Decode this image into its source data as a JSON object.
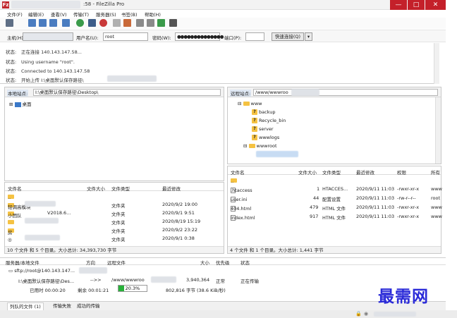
{
  "window": {
    "title": ":58 - FileZilla Pro",
    "app_icon": "Fz",
    "minimize": "—",
    "maximize": "□",
    "close": "✕"
  },
  "menu": [
    "文件(F)",
    "编辑(E)",
    "查看(V)",
    "传输(T)",
    "服务器(S)",
    "书签(B)",
    "帮助(H)"
  ],
  "quickconnect": {
    "host_label": "主机(H):",
    "username_label": "用户名(U):",
    "username_value": "root",
    "password_label": "密码(W):",
    "password_value": "●●●●●●●●●●●●●●",
    "port_label": "端口(P):",
    "port_value": "",
    "connect_button": "快速连接(Q)",
    "dropdown": "▾"
  },
  "log": [
    {
      "key": "状态:",
      "text": "正在连接 140.143.147.58..."
    },
    {
      "key": "状态:",
      "text": "Using username \"root\"."
    },
    {
      "key": "状态:",
      "text": "Connected to 140.143.147.58"
    },
    {
      "key": "状态:",
      "text": "开始上传 I:\\桌面默认保存路径\\"
    }
  ],
  "local": {
    "site_label": "本地站点:",
    "path": "I:\\桌面默认保存路径\\Desktop\\",
    "tree": [
      {
        "label": "桌面"
      }
    ],
    "columns": [
      "文件名",
      "文件大小",
      "文件类型",
      "最近修改"
    ],
    "files": [
      {
        "name": "..",
        "size": "",
        "type": "",
        "modified": ""
      },
      {
        "name": "轻调高模块",
        "size": "",
        "type": "文件夹",
        "modified": "2020/9/2 19:00"
      },
      {
        "name": "小团队",
        "size": "V2018.6...",
        "type": "文件夹",
        "modified": "2020/9/1 9:51"
      },
      {
        "name": "",
        "size": "",
        "type": "文件夹",
        "modified": "2020/8/19 15:19"
      },
      {
        "name": "房",
        "size": "",
        "type": "文件夹",
        "modified": "2020/9/2 23:22"
      },
      {
        "name": "",
        "size": "",
        "type": "文件夹",
        "modified": "2020/9/1 0:38"
      }
    ],
    "status": "10 个文件 和 5 个目录。大小总计: 34,393,730 字节"
  },
  "remote": {
    "site_label": "远程站点:",
    "path": "/www/wwwroo",
    "tree": [
      {
        "label": "www",
        "kind": "folder"
      },
      {
        "label": "backup",
        "kind": "question"
      },
      {
        "label": "Recycle_bin",
        "kind": "question"
      },
      {
        "label": "server",
        "kind": "question"
      },
      {
        "label": "wwwlogs",
        "kind": "question"
      },
      {
        "label": "wwwroot",
        "kind": "folder"
      }
    ],
    "columns": [
      "文件名",
      "文件大小",
      "文件类型",
      "最近修改",
      "权限",
      "所有"
    ],
    "files": [
      {
        "name": "..",
        "size": "",
        "type": "",
        "modified": "",
        "perm": "",
        "owner": ""
      },
      {
        "name": ".htaccess",
        "size": "1",
        "type": "HTACCES...",
        "modified": "2020/9/11 11:03",
        "perm": "-rwxr-xr-x",
        "owner": "www"
      },
      {
        "name": "user.ini",
        "size": "44",
        "type": "配置设置",
        "modified": "2020/9/11 11:03",
        "perm": "-rw-r--r--",
        "owner": "root"
      },
      {
        "name": "404.html",
        "size": "479",
        "type": "HTML 文件",
        "modified": "2020/9/11 11:03",
        "perm": "-rwxr-xr-x",
        "owner": "www"
      },
      {
        "name": "index.html",
        "size": "917",
        "type": "HTML 文件",
        "modified": "2020/9/11 11:03",
        "perm": "-rwxr-xr-x",
        "owner": "www"
      }
    ],
    "status": "4 个文件 和 1 个目录。大小总计: 1,441 字节"
  },
  "queue": {
    "columns": [
      "服务器/本地文件",
      "方向",
      "远程文件",
      "大小",
      "优先级",
      "状态"
    ],
    "server": "sftp://root@140.143.147...",
    "local_file": "I:\\桌面默认保存路径\\Des...",
    "direction": "-->>",
    "remote_file": "/www/wwwroo",
    "size": "3,940,364",
    "priority": "正常",
    "state": "正在传输",
    "elapsed": "已用时 00:00:20",
    "remaining": "剩余 00:01:21",
    "progress_label": "20.3%",
    "progress_fraction": 0.203,
    "transferred": "802,816 字节 (38.6 KiB/秒)"
  },
  "tabs": [
    "列队的文件 (1)",
    "传输失败",
    "成功的传输"
  ],
  "watermark": "最需网",
  "colors": {
    "accent_red": "#c4202a",
    "progress_green": "#28b13a",
    "watermark_blue": "#2a2ad8",
    "folder_yellow": "#f5c242"
  }
}
